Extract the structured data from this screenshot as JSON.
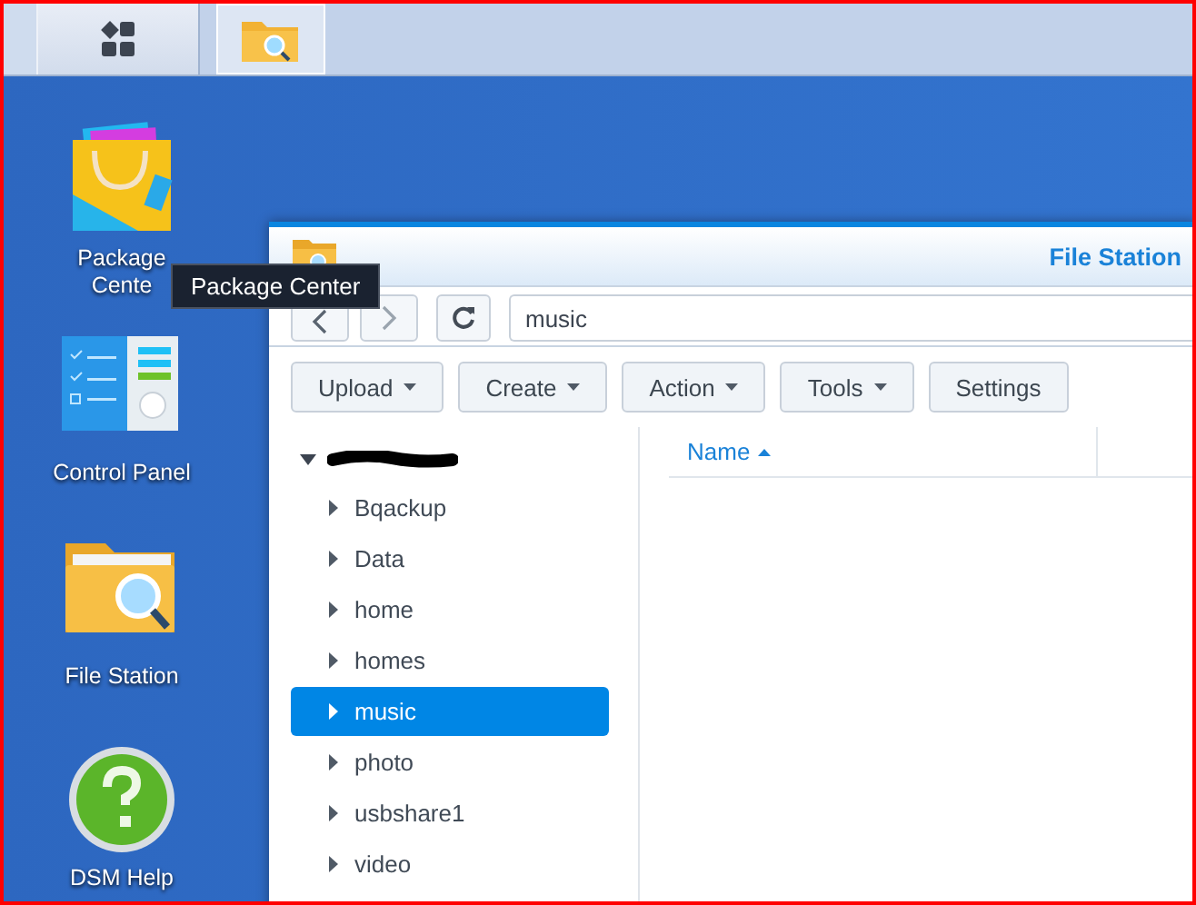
{
  "taskbar": [
    {
      "kind": "main-menu",
      "selected": false
    },
    {
      "kind": "file-station",
      "selected": true
    }
  ],
  "desktop_icons": [
    {
      "kind": "package-center",
      "label": "Package Cente"
    },
    {
      "kind": "control-panel",
      "label": "Control Panel"
    },
    {
      "kind": "file-station",
      "label": "File Station"
    },
    {
      "kind": "dsm-help",
      "label": "DSM Help"
    }
  ],
  "tooltip": {
    "text": "Package Center"
  },
  "window": {
    "title": "File Station",
    "path": "music",
    "toolbar": [
      {
        "label": "Upload",
        "dropdown": true
      },
      {
        "label": "Create",
        "dropdown": true
      },
      {
        "label": "Action",
        "dropdown": true
      },
      {
        "label": "Tools",
        "dropdown": true
      },
      {
        "label": "Settings",
        "dropdown": false
      }
    ],
    "tree": {
      "root": {
        "expanded": true,
        "redacted": true,
        "children": [
          {
            "label": "Bqackup",
            "expanded": false,
            "selected": false
          },
          {
            "label": "Data",
            "expanded": false,
            "selected": false
          },
          {
            "label": "home",
            "expanded": false,
            "selected": false
          },
          {
            "label": "homes",
            "expanded": false,
            "selected": false
          },
          {
            "label": "music",
            "expanded": false,
            "selected": true
          },
          {
            "label": "photo",
            "expanded": false,
            "selected": false
          },
          {
            "label": "usbshare1",
            "expanded": false,
            "selected": false
          },
          {
            "label": "video",
            "expanded": false,
            "selected": false
          }
        ]
      }
    },
    "columns": [
      {
        "label": "Name",
        "sorted_ascending": true
      }
    ]
  }
}
